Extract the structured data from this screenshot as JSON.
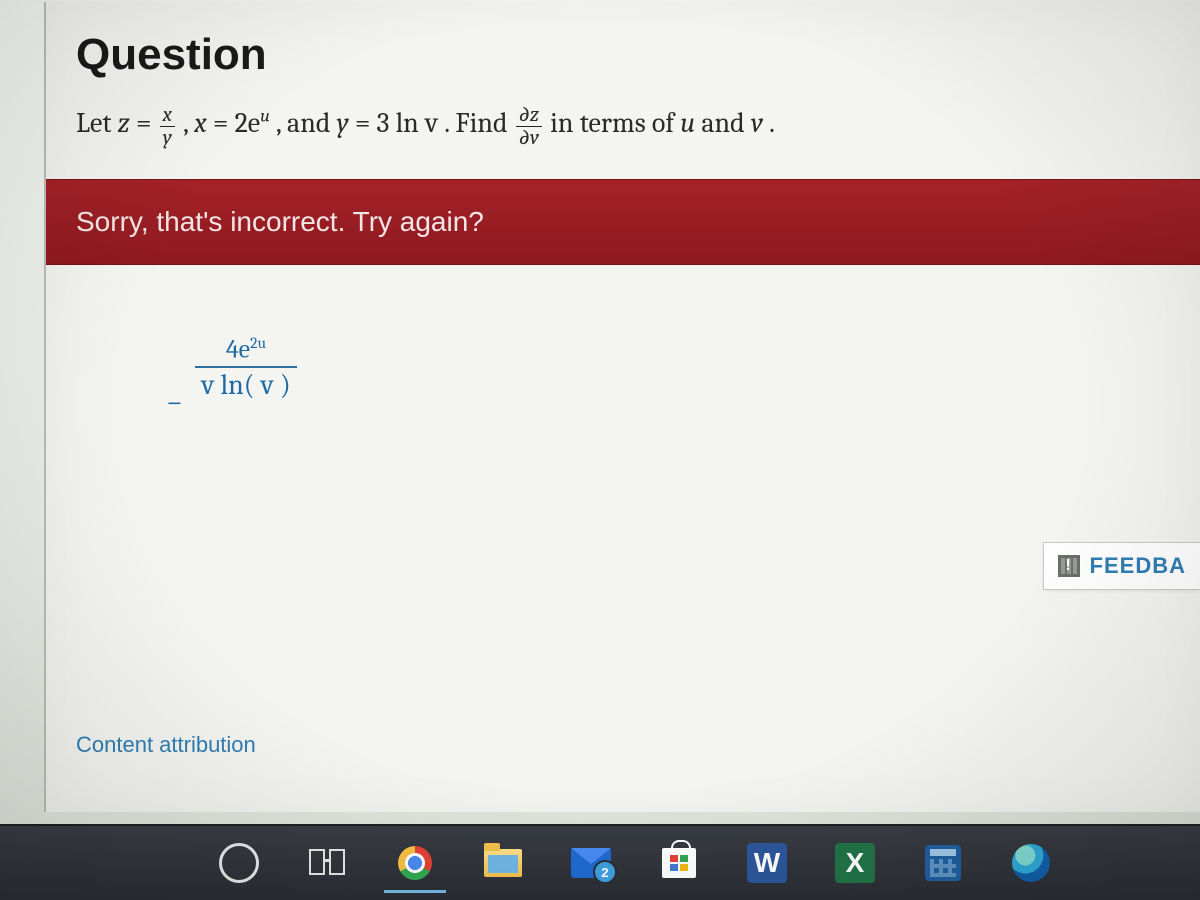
{
  "heading": "Question",
  "prompt": {
    "let": "Let ",
    "z_eq": "z",
    "equals": " = ",
    "frac_x": "x",
    "frac_y": "y",
    "comma": ", ",
    "x_eq": "x",
    "two_e": " = 2e",
    "sup_u": "u",
    "and1": ", and ",
    "y_eq": "y",
    "three_ln": " = 3 ln v",
    "find": ". Find ",
    "dz": "∂z",
    "dv": "∂v",
    "in_terms": " in terms of ",
    "u_var": "u",
    "and2": " and ",
    "v_var": "v",
    "period": "."
  },
  "error_message": "Sorry, that's incorrect. Try again?",
  "answer": {
    "minus": "−",
    "num_coeff": "4e",
    "num_exp": "2u",
    "den": "v ln( v )"
  },
  "feedback_label": "FEEDBA",
  "mail_badge": "2",
  "attribution": "Content attribution",
  "taskbar": {
    "word_letter": "W",
    "excel_letter": "X"
  }
}
